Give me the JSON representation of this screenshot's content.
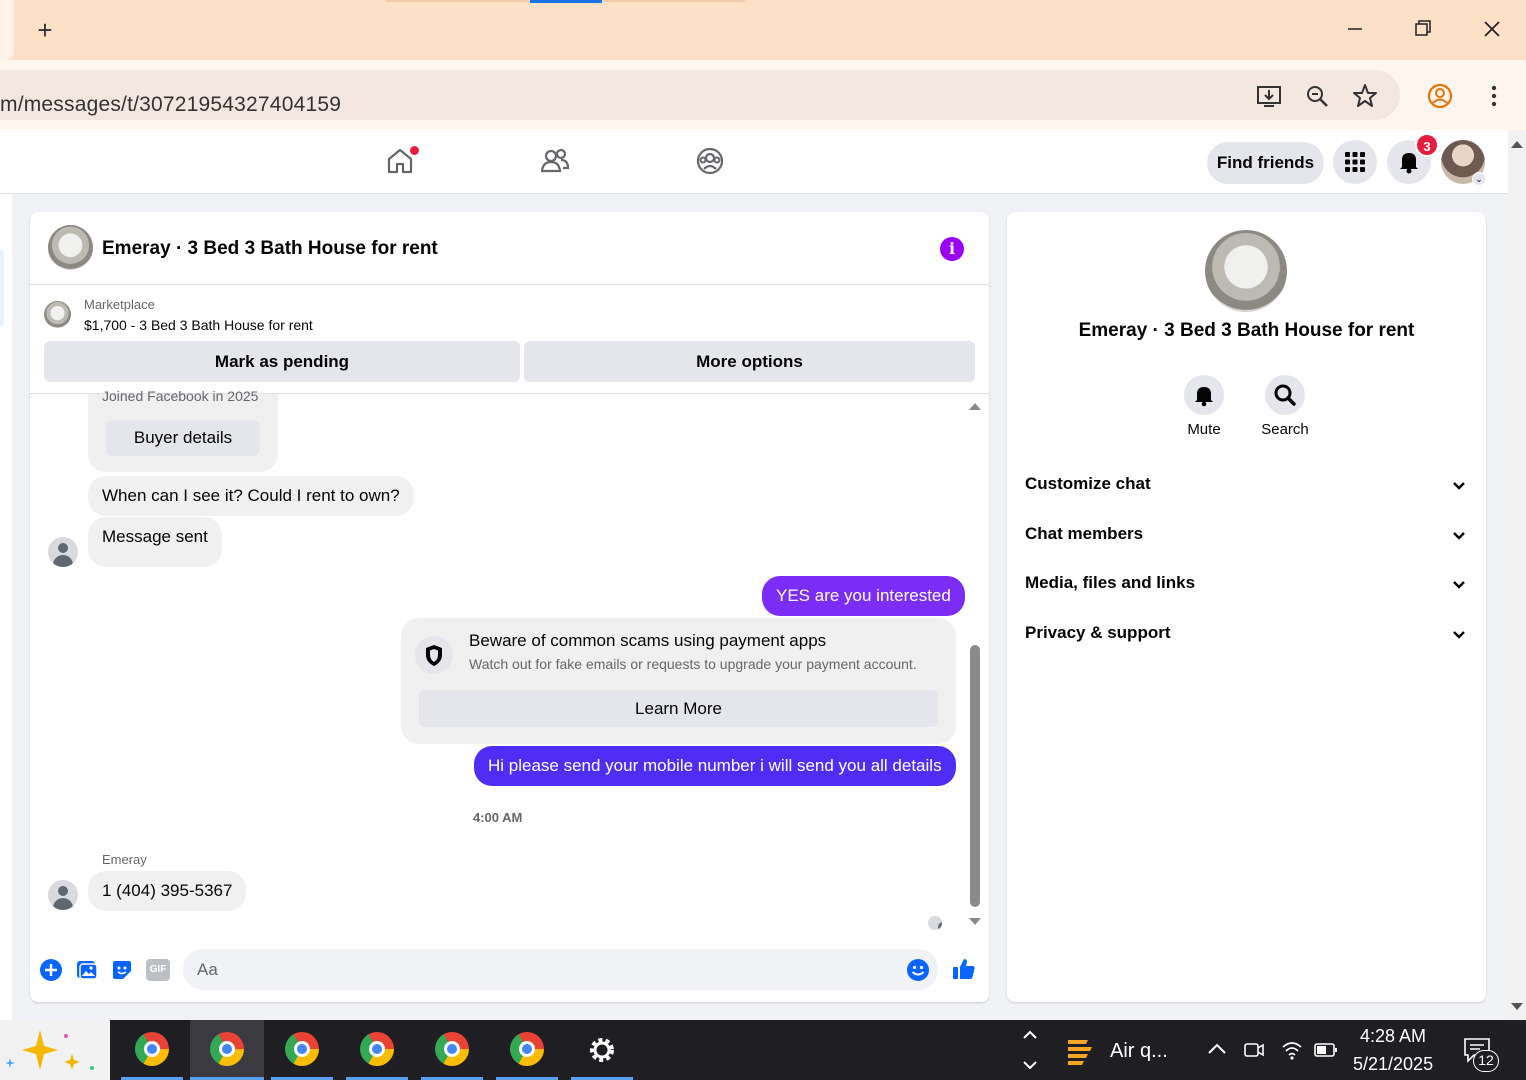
{
  "browser": {
    "url": "m/messages/t/30721954327404159",
    "new_tab_icon": "plus-icon"
  },
  "fb_nav": {
    "find_friends": "Find friends",
    "notification_count": "3"
  },
  "chat": {
    "title": "Emeray · 3 Bed 3 Bath House for rent",
    "marketplace_label": "Marketplace",
    "listing": "$1,700 - 3 Bed 3 Bath House for rent",
    "mark_pending": "Mark as pending",
    "more_options": "More options",
    "joined": "Joined Facebook in 2025",
    "buyer_details": "Buyer details",
    "messages": [
      {
        "from": "them",
        "text": "When can I see it? Could I rent to own?"
      },
      {
        "from": "them",
        "text": "Message sent"
      },
      {
        "from": "me",
        "text": "YES are you interested"
      },
      {
        "from": "me",
        "text": "Hi please send your mobile number  i will send you all details"
      },
      {
        "from": "them",
        "text": "1 (404) 395-5367"
      }
    ],
    "scam_title": "Beware of common scams using payment apps",
    "scam_body": "Watch out for fake emails or requests to upgrade your payment account.",
    "learn_more": "Learn More",
    "timestamp": "4:00 AM",
    "sender_name": "Emeray",
    "input_placeholder": "Aa",
    "gif_label": "GIF"
  },
  "info_panel": {
    "title": "Emeray · 3 Bed 3 Bath House for rent",
    "mute": "Mute",
    "search": "Search",
    "sections": [
      "Customize chat",
      "Chat members",
      "Media, files and links",
      "Privacy & support"
    ]
  },
  "taskbar": {
    "weather": "Air q...",
    "time": "4:28 AM",
    "date": "5/21/2025",
    "notifications": "12"
  },
  "colors": {
    "accent_purple": "#7b2cf5",
    "accent_blue": "#4f2df5",
    "fb_blue": "#0866ff",
    "notification_red": "#e41e3f"
  }
}
